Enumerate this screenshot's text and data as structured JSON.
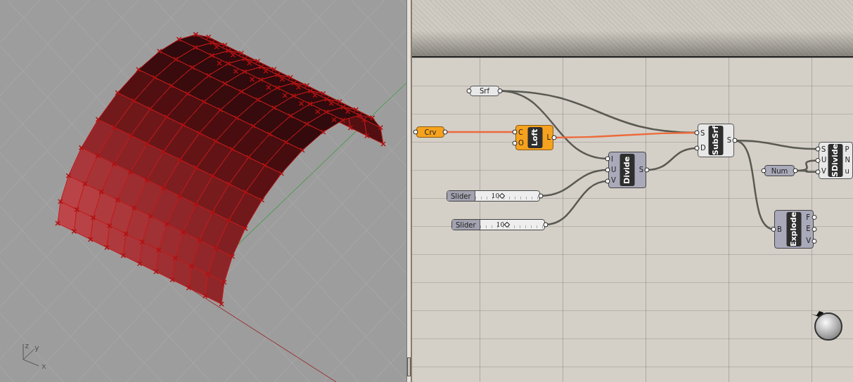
{
  "viewport": {
    "axis_labels": [
      "z",
      "y",
      "x"
    ]
  },
  "canvas": {
    "nodes": [
      {
        "kind": "param",
        "label": "Srf",
        "warning": false,
        "preview": false
      },
      {
        "kind": "param",
        "label": "Crv",
        "warning": true
      },
      {
        "kind": "component",
        "label": "Loft",
        "inputs": [
          "C",
          "O"
        ],
        "outputs": [
          "L"
        ],
        "warning": true
      },
      {
        "kind": "component",
        "label": "Divide",
        "inputs": [
          "I",
          "U",
          "V"
        ],
        "outputs": [
          "S"
        ],
        "warning": false,
        "preview": true
      },
      {
        "kind": "slider",
        "label": "Slider",
        "value": "10",
        "level": 0.42
      },
      {
        "kind": "slider",
        "label": "Slider",
        "value": "10",
        "level": 0.42
      },
      {
        "kind": "component",
        "label": "SubSrf",
        "inputs": [
          "S",
          "D"
        ],
        "outputs": [
          "S"
        ],
        "warning": false,
        "preview": false
      },
      {
        "kind": "param",
        "label": "Num",
        "warning": false,
        "preview": true
      },
      {
        "kind": "component",
        "label": "SDivide",
        "inputs": [
          "S",
          "U",
          "V"
        ],
        "outputs": [
          "P",
          "N",
          "u"
        ],
        "warning": false,
        "preview": false
      },
      {
        "kind": "component",
        "label": "Explode",
        "inputs": [
          "B"
        ],
        "outputs": [
          "F",
          "E",
          "V"
        ],
        "warning": false,
        "preview": true
      }
    ]
  }
}
